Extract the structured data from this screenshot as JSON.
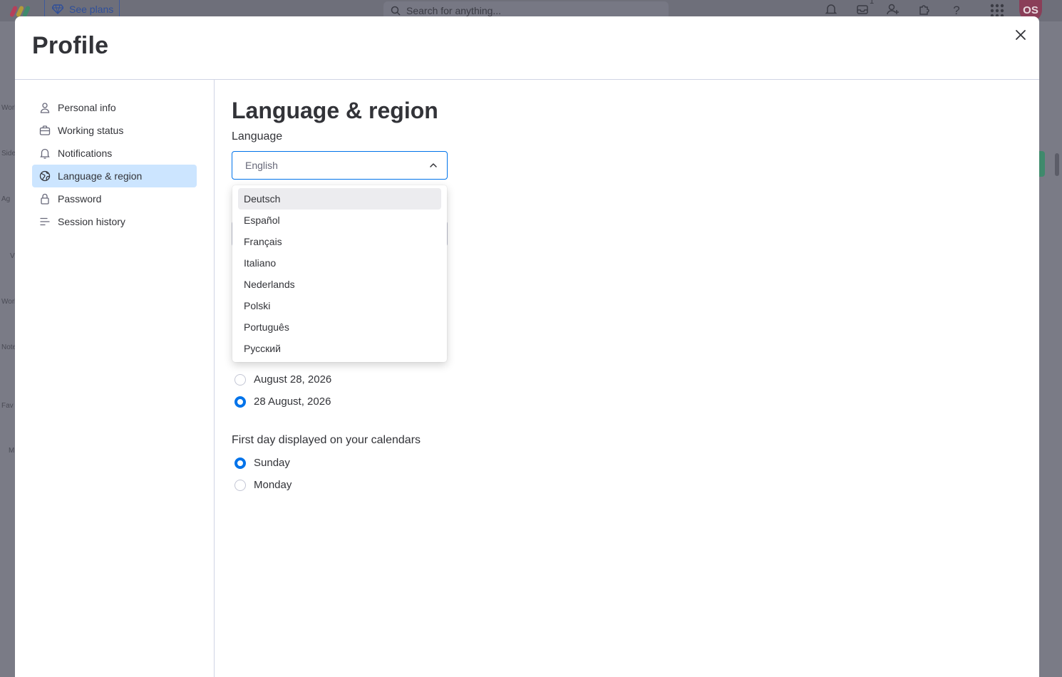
{
  "topbar": {
    "see_plans": "See plans",
    "search_placeholder": "Search for anything...",
    "inbox_badge": "1",
    "avatar_initials": "OS"
  },
  "background_sidebar": [
    "Work",
    "Side",
    "Ag",
    "V",
    "Work",
    "Note",
    "Fav",
    "M"
  ],
  "modal": {
    "title": "Profile",
    "close_label": "×"
  },
  "sidebar": {
    "items": [
      {
        "label": "Personal info",
        "icon": "person-icon"
      },
      {
        "label": "Working status",
        "icon": "briefcase-icon"
      },
      {
        "label": "Notifications",
        "icon": "bell-icon"
      },
      {
        "label": "Language & region",
        "icon": "globe-icon",
        "active": true
      },
      {
        "label": "Password",
        "icon": "lock-icon"
      },
      {
        "label": "Session history",
        "icon": "list-icon"
      }
    ]
  },
  "content": {
    "title": "Language & region",
    "language_label": "Language",
    "language_value": "English",
    "language_options": [
      "Deutsch",
      "Español",
      "Français",
      "Italiano",
      "Nederlands",
      "Polski",
      "Português",
      "Русский"
    ],
    "date_format_options": [
      {
        "label": "August 28, 2026",
        "checked": false
      },
      {
        "label": "28 August, 2026",
        "checked": true
      }
    ],
    "first_day_label": "First day displayed on your calendars",
    "first_day_options": [
      {
        "label": "Sunday",
        "checked": true
      },
      {
        "label": "Monday",
        "checked": false
      }
    ]
  },
  "colors": {
    "accent": "#0073ea",
    "active_nav_bg": "#cce5ff",
    "text": "#323338"
  }
}
